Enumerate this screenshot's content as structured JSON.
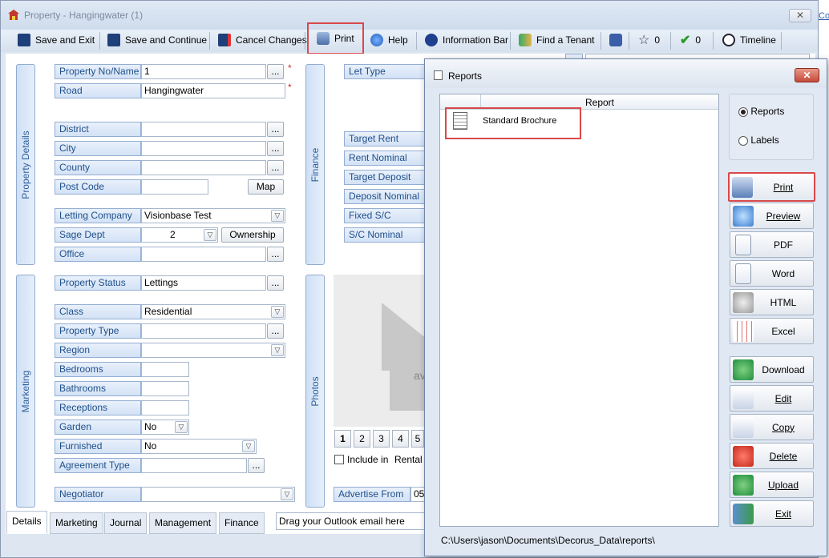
{
  "window": {
    "title": "Property  - Hangingwater (1)",
    "close": "✕"
  },
  "toolbar": {
    "save_exit": "Save and Exit",
    "save_continue": "Save and Continue",
    "cancel": "Cancel Changes",
    "print": "Print",
    "help": "Help",
    "info_bar": "Information Bar",
    "find_tenant": "Find a Tenant",
    "star_count": "0",
    "check_count": "0",
    "timeline": "Timeline"
  },
  "corner_text": "Co",
  "panels": {
    "property_details": "Property Details",
    "marketing": "Marketing",
    "finance": "Finance",
    "photos": "Photos"
  },
  "fields": {
    "property_no": {
      "label": "Property No/Name",
      "value": "1"
    },
    "road": {
      "label": "Road",
      "value": "Hangingwater"
    },
    "district": {
      "label": "District",
      "value": ""
    },
    "city": {
      "label": "City",
      "value": ""
    },
    "county": {
      "label": "County",
      "value": ""
    },
    "post_code": {
      "label": "Post Code",
      "value": ""
    },
    "letting_company": {
      "label": "Letting Company",
      "value": "Visionbase Test"
    },
    "sage_dept": {
      "label": "Sage Dept",
      "value": "2"
    },
    "office": {
      "label": "Office",
      "value": ""
    },
    "property_status": {
      "label": "Property Status",
      "value": "Lettings"
    },
    "class": {
      "label": "Class",
      "value": "Residential"
    },
    "property_type": {
      "label": "Property Type",
      "value": ""
    },
    "region": {
      "label": "Region",
      "value": ""
    },
    "bedrooms": {
      "label": "Bedrooms",
      "value": ""
    },
    "bathrooms": {
      "label": "Bathrooms",
      "value": ""
    },
    "receptions": {
      "label": "Receptions",
      "value": ""
    },
    "garden": {
      "label": "Garden",
      "value": "No"
    },
    "furnished": {
      "label": "Furnished",
      "value": "No"
    },
    "agreement_type": {
      "label": "Agreement Type",
      "value": ""
    },
    "negotiator": {
      "label": "Negotiator",
      "value": ""
    }
  },
  "buttons": {
    "ellipsis": "...",
    "map": "Map",
    "ownership": "Ownership",
    "required": "*"
  },
  "finance": {
    "let_type": "Let Type",
    "target_rent": "Target Rent",
    "rent_nominal": "Rent Nominal",
    "target_deposit": "Target Deposit",
    "deposit_nominal": "Deposit Nominal",
    "fixed_sc": "Fixed S/C",
    "sc_nominal": "S/C Nominal"
  },
  "photos": {
    "pages": [
      "1",
      "2",
      "3",
      "4",
      "5"
    ],
    "include_in": "Include in",
    "rental": "Rental",
    "placeholder_text": "av",
    "advertise_from": "Advertise From",
    "advertise_value": "05"
  },
  "tabs": [
    "Details",
    "Marketing",
    "Journal",
    "Management",
    "Finance"
  ],
  "outlook_drop": "Drag your Outlook email here",
  "reports": {
    "title": "Reports",
    "close": "✕",
    "column": "Report",
    "items": [
      "Standard Brochure"
    ],
    "radio_reports": "Reports",
    "radio_labels": "Labels",
    "buttons": [
      {
        "label": "Print",
        "icon": "printer-icon"
      },
      {
        "label": "Preview",
        "icon": "magnifier-icon"
      },
      {
        "label": "PDF",
        "icon": "pdf-document-icon"
      },
      {
        "label": "Word",
        "icon": "word-document-icon"
      },
      {
        "label": "HTML",
        "icon": "web-icon"
      },
      {
        "label": "Excel",
        "icon": "spreadsheet-icon"
      },
      {
        "label": "Download",
        "icon": "download-icon"
      },
      {
        "label": "Edit",
        "icon": "edit-icon"
      },
      {
        "label": "Copy",
        "icon": "copy-icon"
      },
      {
        "label": "Delete",
        "icon": "delete-icon"
      },
      {
        "label": "Upload",
        "icon": "upload-icon"
      },
      {
        "label": "Exit",
        "icon": "exit-icon"
      }
    ],
    "path": "C:\\Users\\jason\\Documents\\Decorus_Data\\reports\\"
  }
}
